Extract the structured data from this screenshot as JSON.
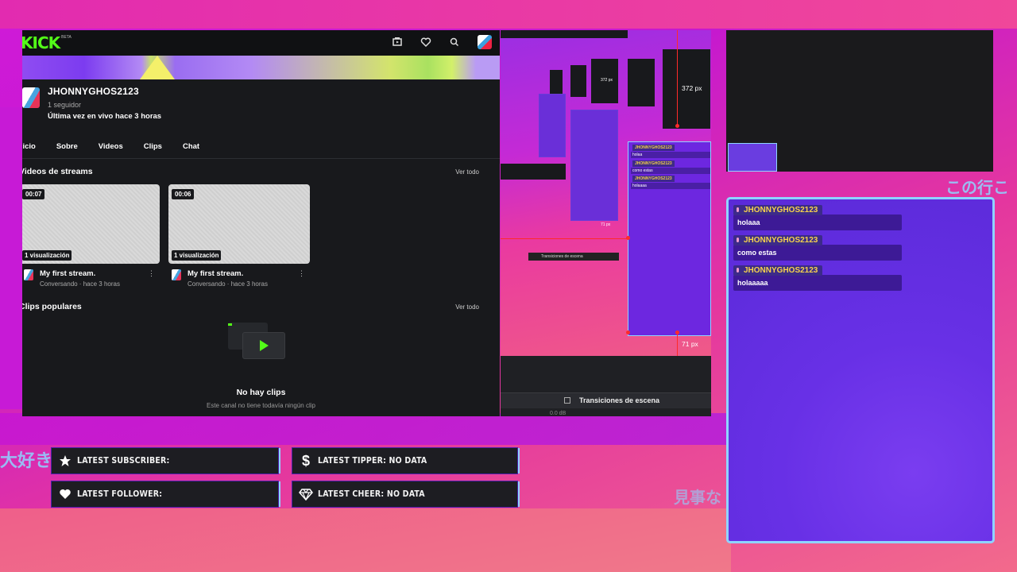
{
  "kick": {
    "logo": "KICK",
    "beta": "BETA",
    "channel": {
      "name": "JHONNYGHOS2123",
      "followers": "1 seguidor",
      "last_live": "Última vez en vivo hace 3 horas"
    },
    "tabs": [
      "Inicio",
      "Sobre",
      "Videos",
      "Clips",
      "Chat"
    ],
    "streams_section": {
      "title": "Videos de streams",
      "link": "Ver todo",
      "videos": [
        {
          "duration": "00:07",
          "views": "1 visualización",
          "title": "My first stream.",
          "meta": "Conversando · hace 3 horas"
        },
        {
          "duration": "00:06",
          "views": "1 visualización",
          "title": "My first stream.",
          "meta": "Conversando · hace 3 horas"
        }
      ]
    },
    "clips_section": {
      "title": "Clips populares",
      "link": "Ver todo",
      "empty_title": "No hay clips",
      "empty_sub": "Este canal no tiene todavía ningún clip"
    }
  },
  "obs": {
    "measure_top": "372 px",
    "measure_bottom": "71 px",
    "mini_measure": "372 px",
    "mini_measure_bottom": "71 px",
    "transitions": "Transiciones de escena",
    "db": "0.0 dB",
    "mini_chat": [
      {
        "user": "JHONNYGHOS2123",
        "text": "holaa"
      },
      {
        "user": "JHONNYGHOS2123",
        "text": "como estas"
      },
      {
        "user": "JHONNYGHOS2123",
        "text": "holaaaa"
      }
    ]
  },
  "chat": {
    "messages": [
      {
        "user": "JHONNYGHOS2123",
        "text": "holaaa"
      },
      {
        "user": "JHONNYGHOS2123",
        "text": "como estas"
      },
      {
        "user": "JHONNYGHOS2123",
        "text": "holaaaaa"
      }
    ]
  },
  "alerts": {
    "subscriber": "LATEST SUBSCRIBER:",
    "tipper": "LATEST TIPPER: NO DATA",
    "follower": "LATEST FOLLOWER:",
    "cheer": "LATEST CHEER: NO DATA"
  },
  "decor": {
    "jp_left": "大好き",
    "jp_right": "この行こ",
    "jp_mid": "見事な"
  },
  "colors": {
    "kick_green": "#53fc18",
    "chat_border": "#8fd4ff",
    "username_gold": "#f7d24b",
    "bubble": "#3d1a96"
  }
}
